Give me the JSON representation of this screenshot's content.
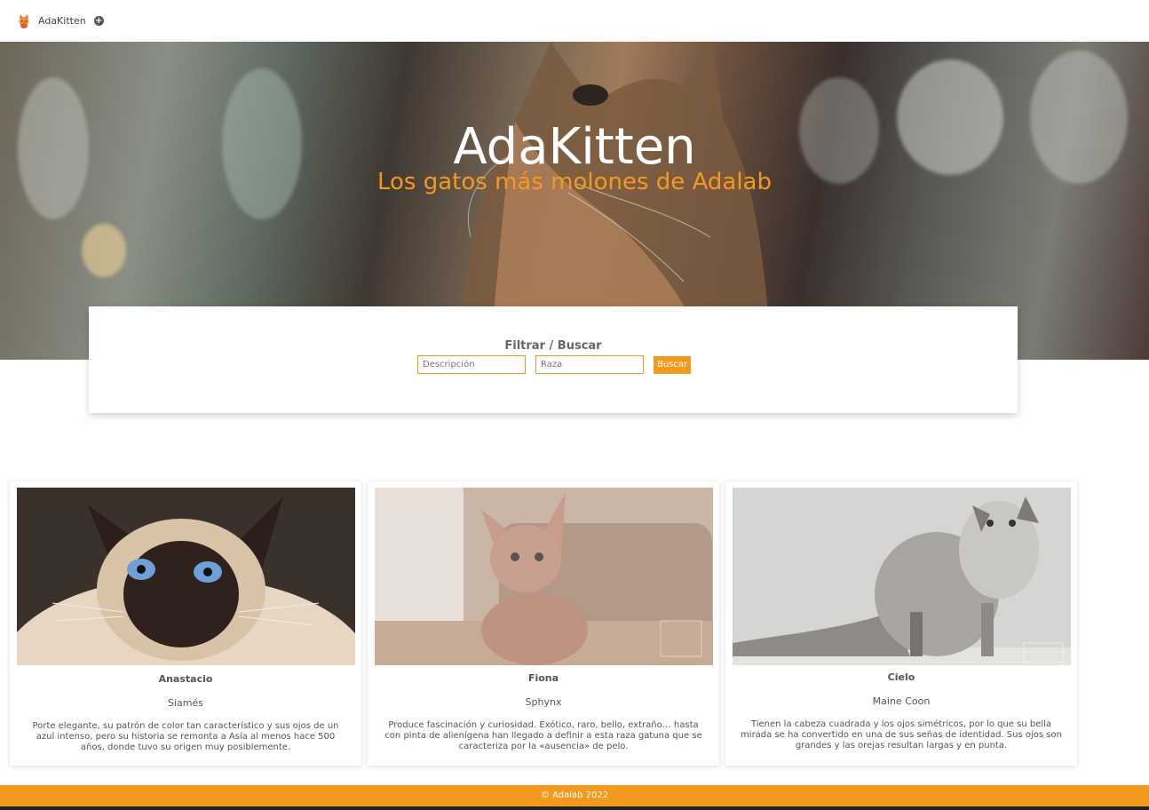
{
  "header": {
    "logo_icon": "kitten-logo-icon",
    "brand": "AdaKitten",
    "add_icon": "plus-circle-icon"
  },
  "hero": {
    "title": "AdaKitten",
    "subtitle": "Los gatos más molones de Adalab"
  },
  "filter": {
    "title": "Filtrar / Buscar",
    "description_placeholder": "Descripción",
    "breed_placeholder": "Raza",
    "search_label": "Buscar"
  },
  "cats": [
    {
      "name": "Anastacio",
      "breed": "Siamés",
      "description": "Porte elegante, su patrón de color tan característico y sus ojos de un azul intenso, pero su historia se remonta a Asía al menos hace 500 años, donde tuvo su origen muy posiblemente."
    },
    {
      "name": "Fiona",
      "breed": "Sphynx",
      "description": "Produce fascinación y curiosidad. Exótico, raro, bello, extraño… hasta con pinta de alienígena han llegado a definir a esta raza gatuna que se caracteriza por la «ausencia» de pelo."
    },
    {
      "name": "Cielo",
      "breed": "Maine Coon",
      "description": "Tienen la cabeza cuadrada y los ojos simétricos, por lo que su bella mirada se ha convertido en una de sus señas de identidad. Sus ojos son grandes y las orejas resultan largas y en punta."
    }
  ],
  "footer": {
    "text": "© Adalab 2022"
  },
  "colors": {
    "accent": "#f39a1e"
  }
}
